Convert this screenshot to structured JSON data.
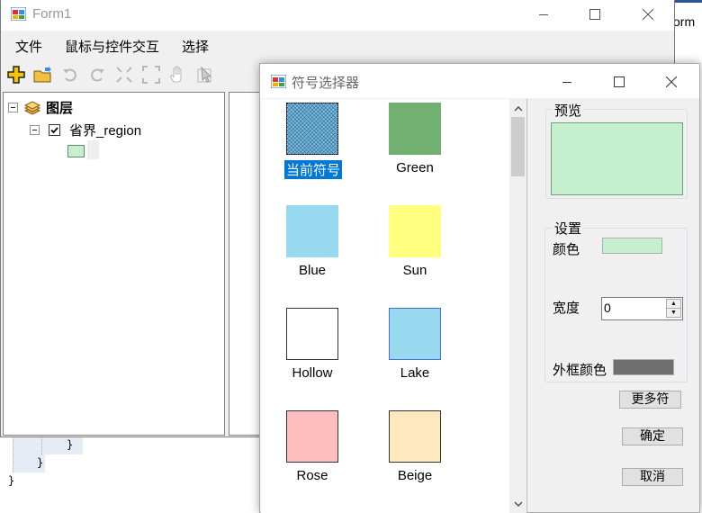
{
  "main_window": {
    "title": "Form1",
    "menu": [
      {
        "label": "文件"
      },
      {
        "label": "鼠标与控件交互"
      },
      {
        "label": "选择"
      }
    ],
    "toolbar": [
      {
        "icon": "add-data-icon",
        "enabled": true
      },
      {
        "icon": "open-folder-icon",
        "enabled": true
      },
      {
        "icon": "undo-icon",
        "enabled": false
      },
      {
        "icon": "redo-icon",
        "enabled": false
      },
      {
        "icon": "zoom-in-fixed-icon",
        "enabled": false
      },
      {
        "icon": "full-extent-icon",
        "enabled": false
      },
      {
        "icon": "pan-hand-icon",
        "enabled": false
      },
      {
        "icon": "identify-icon",
        "enabled": false
      }
    ],
    "toc": {
      "root_label": "图层",
      "layer_label": "省界_region",
      "layer_checked": true,
      "legend_color": "#c6efce"
    }
  },
  "partial_window_title": "orm",
  "code_lines": [
    "}",
    "}",
    "}"
  ],
  "symbol_dialog": {
    "title": "符号选择器",
    "symbols": [
      {
        "label": "当前符号",
        "fill": "#7ec0d8",
        "border": "#2b579a",
        "selected": true
      },
      {
        "label": "Green",
        "fill": "#72b072",
        "border": "#72b072",
        "selected": false
      },
      {
        "label": "Blue",
        "fill": "#99d9f0",
        "border": "#99d9f0",
        "selected": false
      },
      {
        "label": "Sun",
        "fill": "#ffff80",
        "border": "#ffff80",
        "selected": false
      },
      {
        "label": "Hollow",
        "fill": "#ffffff",
        "border": "#333333",
        "selected": false
      },
      {
        "label": "Lake",
        "fill": "#99d9f0",
        "border": "#4a6ed0",
        "selected": false
      },
      {
        "label": "Rose",
        "fill": "#ffbebe",
        "border": "#333333",
        "selected": false
      },
      {
        "label": "Beige",
        "fill": "#ffe8be",
        "border": "#333333",
        "selected": false
      }
    ],
    "preview": {
      "group_label": "预览",
      "fill": "#c6efce",
      "border": "#6f9f7f"
    },
    "settings": {
      "group_label": "设置",
      "color_label": "颜色",
      "color_value": "#c6efce",
      "width_label": "宽度",
      "width_value": "0",
      "outline_color_label": "外框颜色",
      "outline_color_value": "#6e6e6e"
    },
    "buttons": {
      "more_symbols": "更多符",
      "ok": "确定",
      "cancel": "取消"
    },
    "colors": {
      "selection": "#0078d7"
    }
  }
}
